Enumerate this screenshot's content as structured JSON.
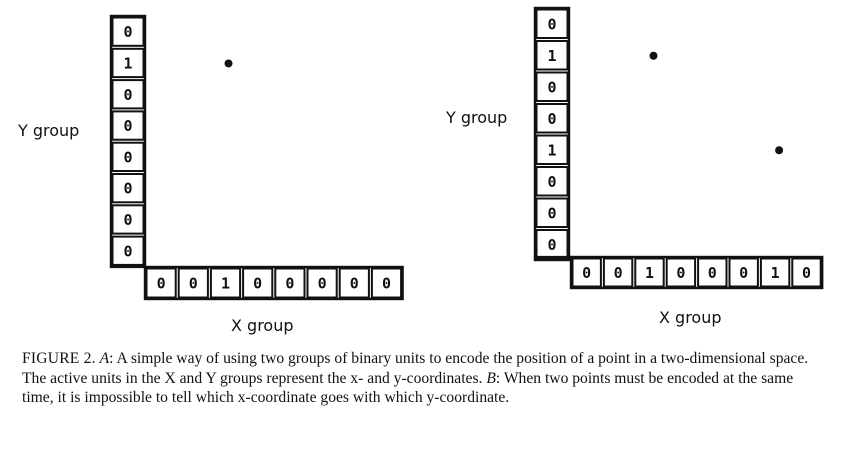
{
  "panels": [
    {
      "id": "A",
      "y_group_label": "Y group",
      "x_group_label": "X group",
      "y_units": [
        "0",
        "1",
        "0",
        "0",
        "0",
        "0",
        "0",
        "0"
      ],
      "x_units": [
        "0",
        "0",
        "1",
        "0",
        "0",
        "0",
        "0",
        "0"
      ],
      "points": 1
    },
    {
      "id": "B",
      "y_group_label": "Y group",
      "x_group_label": "X group",
      "y_units": [
        "0",
        "1",
        "0",
        "0",
        "1",
        "0",
        "0",
        "0"
      ],
      "x_units": [
        "0",
        "0",
        "1",
        "0",
        "0",
        "0",
        "1",
        "0"
      ],
      "points": 2
    }
  ],
  "caption": {
    "figure_label": "FIGURE 2.",
    "label_a": "A",
    "text_a": ": A simple way of using two groups of binary units to encode the position of a point in a two-dimensional space. The active units in the X and Y groups represent the x- and y-coordinates.",
    "label_b": "B",
    "text_b": ": When two points must be encoded at the same time, it is impossible to tell which x-coordinate goes with which y-coordinate."
  }
}
